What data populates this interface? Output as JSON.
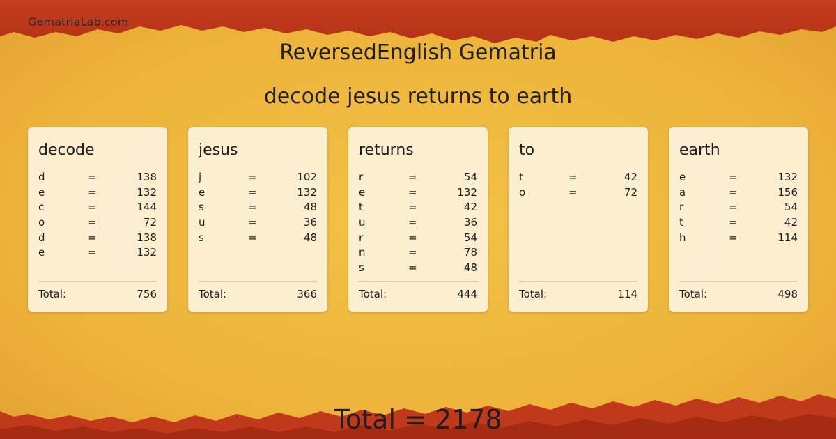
{
  "site": {
    "name": "GematriaLab.com"
  },
  "header": {
    "title": "ReversedEnglish Gematria",
    "phrase": "decode jesus returns to earth"
  },
  "cards": [
    {
      "word": "decode",
      "letters": [
        {
          "letter": "d",
          "eq": "=",
          "value": "138"
        },
        {
          "letter": "e",
          "eq": "=",
          "value": "132"
        },
        {
          "letter": "c",
          "eq": "=",
          "value": "144"
        },
        {
          "letter": "o",
          "eq": "=",
          "value": "72"
        },
        {
          "letter": "d",
          "eq": "=",
          "value": "138"
        },
        {
          "letter": "e",
          "eq": "=",
          "value": "132"
        }
      ],
      "total_label": "Total:",
      "total": "756"
    },
    {
      "word": "jesus",
      "letters": [
        {
          "letter": "j",
          "eq": "=",
          "value": "102"
        },
        {
          "letter": "e",
          "eq": "=",
          "value": "132"
        },
        {
          "letter": "s",
          "eq": "=",
          "value": "48"
        },
        {
          "letter": "u",
          "eq": "=",
          "value": "36"
        },
        {
          "letter": "s",
          "eq": "=",
          "value": "48"
        }
      ],
      "total_label": "Total:",
      "total": "366"
    },
    {
      "word": "returns",
      "letters": [
        {
          "letter": "r",
          "eq": "=",
          "value": "54"
        },
        {
          "letter": "e",
          "eq": "=",
          "value": "132"
        },
        {
          "letter": "t",
          "eq": "=",
          "value": "42"
        },
        {
          "letter": "u",
          "eq": "=",
          "value": "36"
        },
        {
          "letter": "r",
          "eq": "=",
          "value": "54"
        },
        {
          "letter": "n",
          "eq": "=",
          "value": "78"
        },
        {
          "letter": "s",
          "eq": "=",
          "value": "48"
        }
      ],
      "total_label": "Total:",
      "total": "444"
    },
    {
      "word": "to",
      "letters": [
        {
          "letter": "t",
          "eq": "=",
          "value": "42"
        },
        {
          "letter": "o",
          "eq": "=",
          "value": "72"
        }
      ],
      "total_label": "Total:",
      "total": "114"
    },
    {
      "word": "earth",
      "letters": [
        {
          "letter": "e",
          "eq": "=",
          "value": "132"
        },
        {
          "letter": "a",
          "eq": "=",
          "value": "156"
        },
        {
          "letter": "r",
          "eq": "=",
          "value": "54"
        },
        {
          "letter": "t",
          "eq": "=",
          "value": "42"
        },
        {
          "letter": "h",
          "eq": "=",
          "value": "114"
        }
      ],
      "total_label": "Total:",
      "total": "498"
    }
  ],
  "footer": {
    "grand_total": "Total = 2178"
  },
  "colors": {
    "parchment": "#efb438",
    "border_red": "#c0391a",
    "card": "#fdf3dc"
  }
}
